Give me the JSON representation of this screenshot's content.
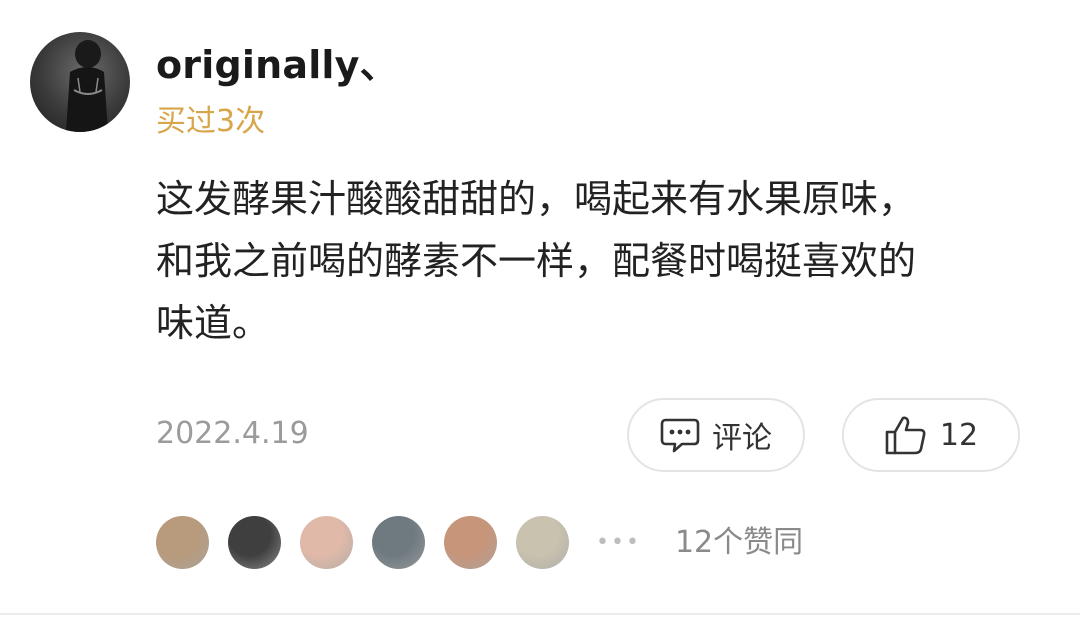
{
  "review": {
    "username": "originally、",
    "purchase_tag": "买过3次",
    "text_lines": [
      "这发酵果汁酸酸甜甜的，喝起来有水果原味，",
      "和我之前喝的酵素不一样，配餐时喝挺喜欢的",
      "味道。"
    ],
    "date": "2022.4.19"
  },
  "actions": {
    "comment_label": "评论",
    "like_count": "12"
  },
  "likers": {
    "summary": "12个赞同",
    "more_icon": "ellipsis-icon",
    "avatar_colors": [
      "#b89a7c",
      "#3f3f3f",
      "#e0b9a8",
      "#6f7a80",
      "#c7957a",
      "#c8c2ae"
    ]
  },
  "icons": {
    "comment": "comment-bubble-icon",
    "like": "thumbs-up-icon"
  },
  "colors": {
    "purchase_tag": "#d7a54a",
    "text": "#222222",
    "muted": "#9b9b9b"
  }
}
